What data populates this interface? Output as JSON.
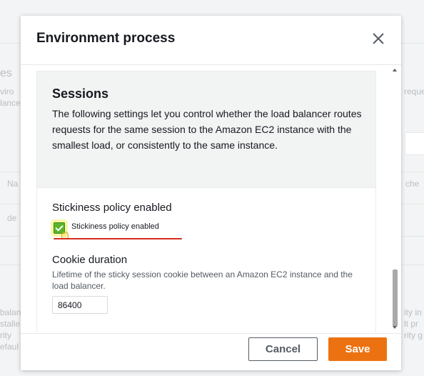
{
  "background": {
    "fragments": [
      "es",
      "viro",
      "lance",
      "Na",
      "de",
      "reque",
      "che",
      "ity in",
      "lt pr",
      "rity g",
      "balanc",
      "stalle",
      "rity",
      "efaul"
    ]
  },
  "dialog": {
    "title": "Environment process",
    "close_icon": "close-icon"
  },
  "sessions": {
    "title": "Sessions",
    "description": "The following settings let you control whether the load balancer routes requests for the same session to the Amazon EC2 instance with the smallest load, or consistently to the same instance."
  },
  "stickiness": {
    "label": "Stickiness policy enabled",
    "checkbox_label": "Stickiness policy enabled",
    "checked": true
  },
  "cookie_duration": {
    "label": "Cookie duration",
    "help": "Lifetime of the sticky session cookie between an Amazon EC2 instance and the load balancer.",
    "value": "86400"
  },
  "footer": {
    "cancel_label": "Cancel",
    "save_label": "Save"
  },
  "colors": {
    "accent": "#ec7211",
    "checkbox": "#5ab42b",
    "annotation": "#d62b1f"
  }
}
